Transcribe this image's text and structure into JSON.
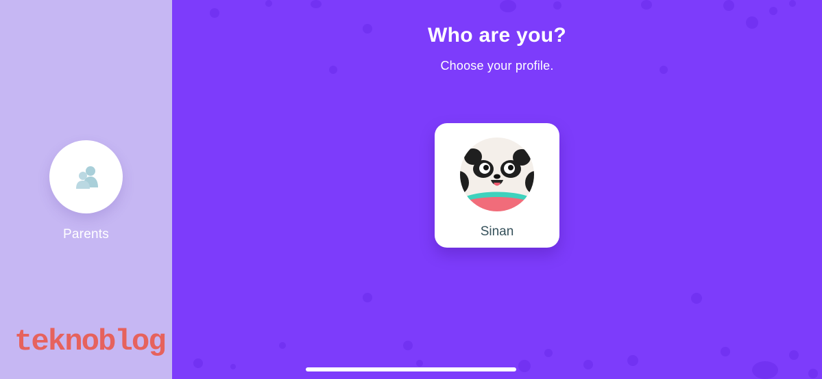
{
  "sidebar": {
    "parents_label": "Parents",
    "parents_icon": "family-icon",
    "brand_logo": "teknoblog"
  },
  "main": {
    "title": "Who are you?",
    "subtitle": "Choose your profile.",
    "profiles": [
      {
        "name": "Sinan",
        "avatar_icon": "panda-avatar-icon"
      }
    ]
  },
  "colors": {
    "sidebar_bg": "#c6b7f3",
    "main_bg": "#7d3cfb",
    "card_bg": "#ffffff",
    "brand_red": "#e6625d",
    "profile_text": "#35505a"
  }
}
